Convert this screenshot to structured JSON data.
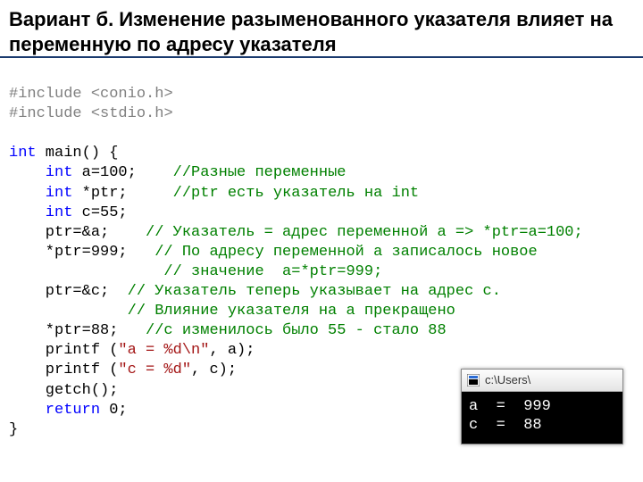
{
  "title": "Вариант б. Изменение разыменованного указателя влияет на переменную по адресу указателя",
  "code": {
    "l01a": "#include",
    "l01b": " <conio.h>",
    "l02a": "#include",
    "l02b": " <stdio.h>",
    "l03": "",
    "l04a": "int",
    "l04b": " main() {",
    "l05a": "    int",
    "l05b": " a=100;",
    "l05c": "    //Разные переменные",
    "l06a": "    int",
    "l06b": " *ptr;",
    "l06c": "     //ptr есть указатель на int",
    "l07a": "    int",
    "l07b": " c=55;",
    "l08a": "    ptr=&a;",
    "l08b": "    // Указатель = адрес переменной a => *ptr=a=100;",
    "l09a": "    *ptr=999;",
    "l09b": "   // По адресу переменной a записалось новое",
    "l10a": "              ",
    "l10b": "   // значение  a=*ptr=999;",
    "l11a": "    ptr=&c;",
    "l11b": "  // Указатель теперь указывает на адрес c.",
    "l12a": "           ",
    "l12b": "  // Влияние указателя на a прекращено",
    "l13a": "    *ptr=88;",
    "l13b": "   //с изменилось было 55 - стало 88",
    "l14a": "    printf (",
    "l14b": "\"a = %d\\n\"",
    "l14c": ", a);",
    "l15a": "    printf (",
    "l15b": "\"c = %d\"",
    "l15c": ", c);",
    "l16a": "    getch();",
    "l17a": "    return",
    "l17b": " 0;",
    "l18": "}"
  },
  "console": {
    "title": "c:\\Users\\",
    "line1": "a  =  999",
    "line2": "c  =  88"
  }
}
